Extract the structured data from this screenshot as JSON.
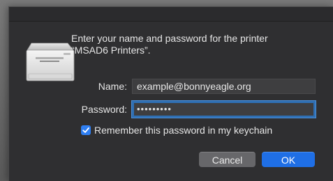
{
  "dialog": {
    "message_line1": "Enter your name and password for the printer",
    "message_line2": "“MSAD6 Printers”.",
    "name_label": "Name:",
    "name_value": "example@bonnyeagle.org",
    "password_label": "Password:",
    "password_value": "•••••••••",
    "remember_checked": true,
    "remember_label": "Remember this password in my keychain",
    "cancel_label": "Cancel",
    "ok_label": "OK"
  },
  "colors": {
    "accent": "#1f6fe6",
    "dialog_bg": "#2f2f31",
    "text": "#e6e6e6"
  },
  "icons": {
    "printer": "printer-icon",
    "checkmark": "checkmark-icon"
  }
}
